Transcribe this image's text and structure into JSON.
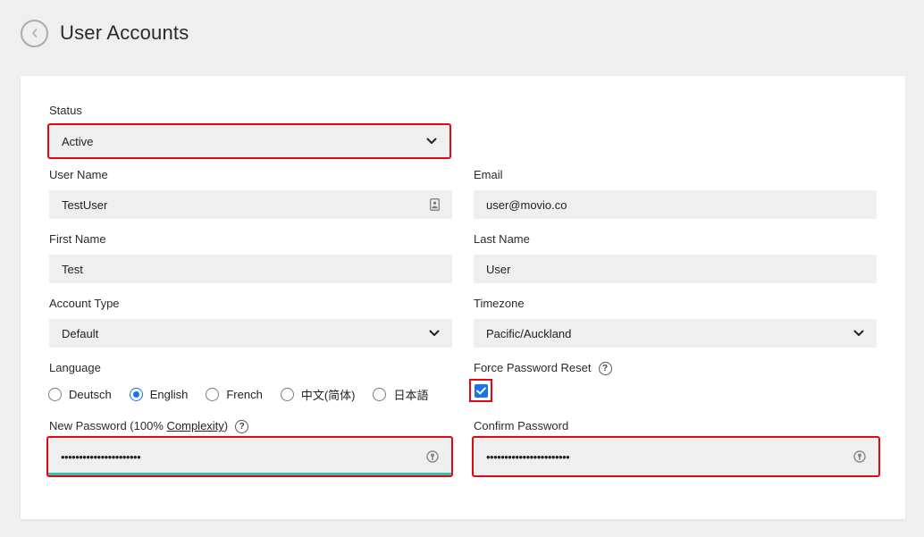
{
  "header": {
    "title": "User Accounts"
  },
  "colors": {
    "background": "#eeefee",
    "card": "#ffffff",
    "field": "#eeefee",
    "highlight": "#e30613",
    "accent": "#1a73e8",
    "strength": "#33c4a8"
  },
  "icons": {
    "back": "chevron-left-icon",
    "select": "chevron-down-icon",
    "contact": "contact-card-icon",
    "password": "password-reveal-icon",
    "help": "question-circle-icon"
  },
  "form": {
    "status": {
      "label": "Status",
      "value": "Active"
    },
    "username": {
      "label": "User Name",
      "value": "TestUser"
    },
    "email": {
      "label": "Email",
      "value": "user@movio.co"
    },
    "first_name": {
      "label": "First Name",
      "value": "Test"
    },
    "last_name": {
      "label": "Last Name",
      "value": "User"
    },
    "account_type": {
      "label": "Account Type",
      "value": "Default"
    },
    "timezone": {
      "label": "Timezone",
      "value": "Pacific/Auckland"
    },
    "language": {
      "label": "Language",
      "options": [
        "Deutsch",
        "English",
        "French",
        "中文(简体)",
        "日本語"
      ],
      "selected": "English"
    },
    "force_reset": {
      "label": "Force Password Reset",
      "help": "?",
      "checked": true
    },
    "new_password": {
      "label_prefix": "New Password (100% ",
      "label_link": "Complexity",
      "label_suffix": ")",
      "help": "?",
      "value": "••••••••••••••••••••••",
      "strength": 1.0
    },
    "confirm_password": {
      "label": "Confirm Password",
      "value": "•••••••••••••••••••••••"
    }
  }
}
